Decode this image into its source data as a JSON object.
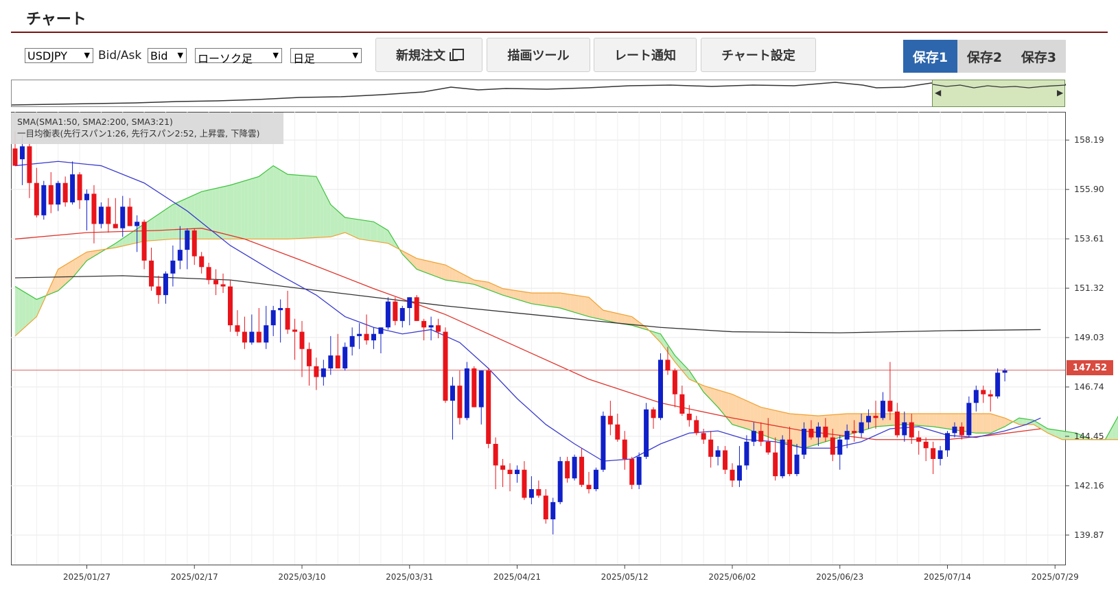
{
  "page": {
    "title": "チャート"
  },
  "toolbar": {
    "symbol": "USDJPY",
    "bidask_label": "Bid/Ask",
    "bidask_value": "Bid",
    "chart_type": "ローソク足",
    "period": "日足",
    "new_order_label": "新規注文",
    "draw_tool_label": "描画ツール",
    "rate_alert_label": "レート通知",
    "chart_settings_label": "チャート設定",
    "saves": [
      "保存1",
      "保存2",
      "保存3"
    ],
    "active_save": "保存1"
  },
  "legend": {
    "sma": "SMA(SMA1:50, SMA2:200, SMA3:21)",
    "ichimoku": "一目均衡表(先行スパン1:26, 先行スパン2:52, 上昇雲, 下降雲)"
  },
  "last_price_label": "147.52",
  "colors": {
    "up": "#e8141a",
    "down": "#1020c8",
    "sma1": "#e0332a",
    "sma2": "#333333",
    "sma3": "#3a3acf",
    "cloud_up": "#bfeebe",
    "cloud_down": "#fdd5a6",
    "span1": "#3cc23c",
    "span2": "#f0a030",
    "price_line": "#e08080",
    "accent": "#2d66ad"
  },
  "chart_data": {
    "type": "candlestick",
    "y_axis_ticks": [
      "158.19",
      "155.90",
      "153.61",
      "151.32",
      "149.03",
      "146.74",
      "144.45",
      "142.16",
      "139.87"
    ],
    "ylim": [
      138.5,
      159.5
    ],
    "x_axis_ticks": [
      "2025/01/27",
      "2025/02/17",
      "2025/03/10",
      "2025/03/31",
      "2025/04/21",
      "2025/05/12",
      "2025/06/02",
      "2025/06/23",
      "2025/07/14",
      "2025/07/29"
    ],
    "last_price": 147.52,
    "candles": [
      [
        157.8,
        158.6,
        157.0,
        157.0
      ],
      [
        157.3,
        158.4,
        156.1,
        157.9
      ],
      [
        157.9,
        158.1,
        155.5,
        156.2
      ],
      [
        156.2,
        156.9,
        154.6,
        154.7
      ],
      [
        154.7,
        156.3,
        154.5,
        156.1
      ],
      [
        156.1,
        156.7,
        154.8,
        155.2
      ],
      [
        155.2,
        156.3,
        154.9,
        156.2
      ],
      [
        156.2,
        156.5,
        155.1,
        155.3
      ],
      [
        155.3,
        157.2,
        155.2,
        156.6
      ],
      [
        156.6,
        156.7,
        155.0,
        155.4
      ],
      [
        155.4,
        155.9,
        154.0,
        155.7
      ],
      [
        155.7,
        156.1,
        153.4,
        154.3
      ],
      [
        154.3,
        155.3,
        154.1,
        155.1
      ],
      [
        155.1,
        155.5,
        153.9,
        154.3
      ],
      [
        154.3,
        155.5,
        154.1,
        154.1
      ],
      [
        154.1,
        155.6,
        153.7,
        155.1
      ],
      [
        155.1,
        155.5,
        154.2,
        154.2
      ],
      [
        154.2,
        154.7,
        153.0,
        154.4
      ],
      [
        154.4,
        154.5,
        152.2,
        152.6
      ],
      [
        152.6,
        153.2,
        151.2,
        151.4
      ],
      [
        151.4,
        151.9,
        150.6,
        151.0
      ],
      [
        151.0,
        152.1,
        150.6,
        152.0
      ],
      [
        152.0,
        153.3,
        151.4,
        152.6
      ],
      [
        152.6,
        154.2,
        152.2,
        153.1
      ],
      [
        153.1,
        154.1,
        152.2,
        154.0
      ],
      [
        154.0,
        154.1,
        152.4,
        152.8
      ],
      [
        152.8,
        153.0,
        152.0,
        152.3
      ],
      [
        152.3,
        152.5,
        151.5,
        151.7
      ],
      [
        151.7,
        152.2,
        151.0,
        151.5
      ],
      [
        151.5,
        152.0,
        151.1,
        151.4
      ],
      [
        151.4,
        151.7,
        149.3,
        149.6
      ],
      [
        149.6,
        150.3,
        149.1,
        149.3
      ],
      [
        149.3,
        150.0,
        148.5,
        148.8
      ],
      [
        148.8,
        150.1,
        148.7,
        149.3
      ],
      [
        149.3,
        150.4,
        148.8,
        148.8
      ],
      [
        148.8,
        150.5,
        148.5,
        149.6
      ],
      [
        149.6,
        150.5,
        149.1,
        150.3
      ],
      [
        150.3,
        150.8,
        148.8,
        150.4
      ],
      [
        150.4,
        151.2,
        149.2,
        149.4
      ],
      [
        149.4,
        149.9,
        148.0,
        149.3
      ],
      [
        149.3,
        149.8,
        147.2,
        148.5
      ],
      [
        148.5,
        148.8,
        146.8,
        147.7
      ],
      [
        147.7,
        148.1,
        146.6,
        147.2
      ],
      [
        147.2,
        148.0,
        146.8,
        147.6
      ],
      [
        147.6,
        149.1,
        147.3,
        148.2
      ],
      [
        148.2,
        149.2,
        147.8,
        147.6
      ],
      [
        147.6,
        148.8,
        147.5,
        148.6
      ],
      [
        148.6,
        149.5,
        148.2,
        149.1
      ],
      [
        149.1,
        149.7,
        148.5,
        149.2
      ],
      [
        149.2,
        150.1,
        148.7,
        148.9
      ],
      [
        148.9,
        149.5,
        148.5,
        149.2
      ],
      [
        149.2,
        149.5,
        148.3,
        149.5
      ],
      [
        149.5,
        150.9,
        149.4,
        150.7
      ],
      [
        150.7,
        150.9,
        149.6,
        149.8
      ],
      [
        149.8,
        150.5,
        149.5,
        150.4
      ],
      [
        150.4,
        150.9,
        149.6,
        150.9
      ],
      [
        150.9,
        151.0,
        149.8,
        149.8
      ],
      [
        149.8,
        149.9,
        148.9,
        149.5
      ],
      [
        149.5,
        150.0,
        148.9,
        149.6
      ],
      [
        149.6,
        149.9,
        149.0,
        149.3
      ],
      [
        149.3,
        149.5,
        146.0,
        146.1
      ],
      [
        146.1,
        147.2,
        144.3,
        146.8
      ],
      [
        146.8,
        147.5,
        145.0,
        145.3
      ],
      [
        145.3,
        147.9,
        145.2,
        147.6
      ],
      [
        147.6,
        147.7,
        145.8,
        145.8
      ],
      [
        145.8,
        147.5,
        145.0,
        147.5
      ],
      [
        147.5,
        147.6,
        143.9,
        144.1
      ],
      [
        144.1,
        144.4,
        142.0,
        143.1
      ],
      [
        143.1,
        143.4,
        142.1,
        142.9
      ],
      [
        142.9,
        143.2,
        141.9,
        142.7
      ],
      [
        142.7,
        143.1,
        142.3,
        142.9
      ],
      [
        142.9,
        143.3,
        141.5,
        141.6
      ],
      [
        141.6,
        142.6,
        141.3,
        142.0
      ],
      [
        142.0,
        142.4,
        141.6,
        141.7
      ],
      [
        141.7,
        142.0,
        140.4,
        140.6
      ],
      [
        140.6,
        141.6,
        139.9,
        141.4
      ],
      [
        141.4,
        143.5,
        141.3,
        143.3
      ],
      [
        143.3,
        143.5,
        142.3,
        142.5
      ],
      [
        142.5,
        143.6,
        142.4,
        143.5
      ],
      [
        143.5,
        143.9,
        142.1,
        142.2
      ],
      [
        142.2,
        142.8,
        141.8,
        142.0
      ],
      [
        142.0,
        143.0,
        141.9,
        142.9
      ],
      [
        142.9,
        145.6,
        142.8,
        145.4
      ],
      [
        145.4,
        146.1,
        144.5,
        145.0
      ],
      [
        145.0,
        145.5,
        144.2,
        144.3
      ],
      [
        144.3,
        144.7,
        142.9,
        143.4
      ],
      [
        143.4,
        143.5,
        142.0,
        142.2
      ],
      [
        142.2,
        143.7,
        142.0,
        143.5
      ],
      [
        143.5,
        146.0,
        143.4,
        145.7
      ],
      [
        145.7,
        145.8,
        144.8,
        145.3
      ],
      [
        145.3,
        148.3,
        145.2,
        148.0
      ],
      [
        148.0,
        148.6,
        147.3,
        147.5
      ],
      [
        147.5,
        147.6,
        145.8,
        146.4
      ],
      [
        146.4,
        146.8,
        145.4,
        145.5
      ],
      [
        145.5,
        145.9,
        144.9,
        145.2
      ],
      [
        145.2,
        145.4,
        144.5,
        144.6
      ],
      [
        144.6,
        144.8,
        144.1,
        144.3
      ],
      [
        144.3,
        144.7,
        143.0,
        143.5
      ],
      [
        143.5,
        144.0,
        143.1,
        143.8
      ],
      [
        143.8,
        144.0,
        142.7,
        142.9
      ],
      [
        142.9,
        143.2,
        142.1,
        142.4
      ],
      [
        142.4,
        144.0,
        142.1,
        143.1
      ],
      [
        143.1,
        144.5,
        142.9,
        144.2
      ],
      [
        144.2,
        145.1,
        144.0,
        144.7
      ],
      [
        144.7,
        145.1,
        144.0,
        144.2
      ],
      [
        144.2,
        145.3,
        143.6,
        143.7
      ],
      [
        143.7,
        144.4,
        142.4,
        142.6
      ],
      [
        142.6,
        144.5,
        142.5,
        144.3
      ],
      [
        144.3,
        144.9,
        142.6,
        142.7
      ],
      [
        142.7,
        144.1,
        142.6,
        143.6
      ],
      [
        143.6,
        145.1,
        143.4,
        144.8
      ],
      [
        144.8,
        145.2,
        144.3,
        144.4
      ],
      [
        144.4,
        145.1,
        144.0,
        144.9
      ],
      [
        144.9,
        145.3,
        144.2,
        144.4
      ],
      [
        144.4,
        144.8,
        143.3,
        143.6
      ],
      [
        143.6,
        144.5,
        142.9,
        144.3
      ],
      [
        144.3,
        145.0,
        143.9,
        144.7
      ],
      [
        144.7,
        145.2,
        144.2,
        144.6
      ],
      [
        144.6,
        145.5,
        144.4,
        145.1
      ],
      [
        145.1,
        145.7,
        144.8,
        145.4
      ],
      [
        145.4,
        146.1,
        144.8,
        145.3
      ],
      [
        145.3,
        146.5,
        145.2,
        146.1
      ],
      [
        146.1,
        147.9,
        145.2,
        145.6
      ],
      [
        145.6,
        146.0,
        144.4,
        144.5
      ],
      [
        144.5,
        145.6,
        144.2,
        145.1
      ],
      [
        145.1,
        145.5,
        144.1,
        144.4
      ],
      [
        144.4,
        144.7,
        143.6,
        144.2
      ],
      [
        144.2,
        144.4,
        143.3,
        143.9
      ],
      [
        143.9,
        144.2,
        142.7,
        143.4
      ],
      [
        143.4,
        144.0,
        143.1,
        143.8
      ],
      [
        143.8,
        144.7,
        143.5,
        144.6
      ],
      [
        144.6,
        145.1,
        144.4,
        144.9
      ],
      [
        144.9,
        145.1,
        144.3,
        144.5
      ],
      [
        144.5,
        146.3,
        144.4,
        146.0
      ],
      [
        146.0,
        146.8,
        145.6,
        146.6
      ],
      [
        146.6,
        146.8,
        146.0,
        146.4
      ],
      [
        146.4,
        146.6,
        145.6,
        146.3
      ],
      [
        146.3,
        147.6,
        146.2,
        147.4
      ],
      [
        147.4,
        147.6,
        147.0,
        147.5
      ]
    ],
    "sma1": [
      [
        0,
        153.6
      ],
      [
        10,
        153.9
      ],
      [
        20,
        154.0
      ],
      [
        26,
        154.1
      ],
      [
        32,
        153.6
      ],
      [
        40,
        152.6
      ],
      [
        50,
        151.3
      ],
      [
        60,
        150.1
      ],
      [
        70,
        148.6
      ],
      [
        80,
        147.1
      ],
      [
        90,
        146.0
      ],
      [
        100,
        145.3
      ],
      [
        110,
        144.7
      ],
      [
        120,
        144.3
      ],
      [
        130,
        144.3
      ],
      [
        136,
        144.5
      ],
      [
        143,
        144.8
      ]
    ],
    "sma2": [
      [
        0,
        151.8
      ],
      [
        15,
        151.9
      ],
      [
        30,
        151.7
      ],
      [
        45,
        151.1
      ],
      [
        60,
        150.5
      ],
      [
        75,
        150.0
      ],
      [
        90,
        149.5
      ],
      [
        100,
        149.3
      ],
      [
        115,
        149.25
      ],
      [
        130,
        149.35
      ],
      [
        143,
        149.4
      ]
    ],
    "sma3": [
      [
        0,
        157.0
      ],
      [
        6,
        157.2
      ],
      [
        12,
        157.0
      ],
      [
        18,
        156.2
      ],
      [
        24,
        154.9
      ],
      [
        30,
        153.3
      ],
      [
        36,
        152.1
      ],
      [
        42,
        151.0
      ],
      [
        46,
        150.0
      ],
      [
        50,
        149.5
      ],
      [
        54,
        149.2
      ],
      [
        58,
        149.4
      ],
      [
        62,
        148.8
      ],
      [
        66,
        147.6
      ],
      [
        70,
        146.2
      ],
      [
        74,
        145.0
      ],
      [
        78,
        144.1
      ],
      [
        82,
        143.3
      ],
      [
        86,
        143.4
      ],
      [
        90,
        144.1
      ],
      [
        94,
        144.6
      ],
      [
        98,
        144.7
      ],
      [
        102,
        144.3
      ],
      [
        106,
        144.2
      ],
      [
        110,
        143.9
      ],
      [
        114,
        143.9
      ],
      [
        118,
        144.2
      ],
      [
        122,
        144.8
      ],
      [
        126,
        144.9
      ],
      [
        130,
        144.5
      ],
      [
        134,
        144.4
      ],
      [
        138,
        144.7
      ],
      [
        141,
        145.0
      ],
      [
        143,
        145.3
      ]
    ],
    "span1": [
      [
        0,
        151.4
      ],
      [
        3,
        150.8
      ],
      [
        6,
        151.2
      ],
      [
        8,
        151.8
      ],
      [
        10,
        152.6
      ],
      [
        14,
        153.4
      ],
      [
        18,
        154.3
      ],
      [
        22,
        155.2
      ],
      [
        26,
        155.8
      ],
      [
        30,
        156.1
      ],
      [
        34,
        156.5
      ],
      [
        36,
        157.0
      ],
      [
        38,
        156.6
      ],
      [
        42,
        156.5
      ],
      [
        44,
        155.2
      ],
      [
        46,
        154.6
      ],
      [
        50,
        154.4
      ],
      [
        52,
        154.0
      ],
      [
        54,
        152.9
      ],
      [
        56,
        152.2
      ],
      [
        60,
        151.7
      ],
      [
        64,
        151.5
      ],
      [
        68,
        151.0
      ],
      [
        72,
        150.6
      ],
      [
        76,
        150.4
      ],
      [
        80,
        150.0
      ],
      [
        84,
        149.7
      ],
      [
        86,
        149.6
      ],
      [
        88,
        149.4
      ],
      [
        90,
        149.2
      ],
      [
        92,
        148.2
      ],
      [
        94,
        147.5
      ],
      [
        96,
        146.5
      ],
      [
        98,
        145.8
      ],
      [
        100,
        145.0
      ],
      [
        102,
        144.8
      ],
      [
        106,
        144.3
      ],
      [
        110,
        143.9
      ],
      [
        112,
        144.1
      ],
      [
        116,
        144.5
      ],
      [
        120,
        144.9
      ],
      [
        124,
        145.0
      ],
      [
        128,
        144.9
      ],
      [
        132,
        144.7
      ],
      [
        134,
        144.6
      ],
      [
        136,
        144.6
      ],
      [
        138,
        144.9
      ],
      [
        140,
        145.3
      ],
      [
        142,
        145.2
      ],
      [
        144,
        144.8
      ],
      [
        146,
        144.7
      ],
      [
        148,
        144.6
      ],
      [
        150,
        144.3
      ],
      [
        152,
        144.3
      ],
      [
        154,
        145.5
      ],
      [
        158,
        145.5
      ]
    ],
    "span2": [
      [
        0,
        149.1
      ],
      [
        3,
        150.0
      ],
      [
        6,
        152.2
      ],
      [
        10,
        153.0
      ],
      [
        14,
        153.2
      ],
      [
        18,
        153.5
      ],
      [
        22,
        153.6
      ],
      [
        30,
        153.6
      ],
      [
        38,
        153.6
      ],
      [
        44,
        153.7
      ],
      [
        46,
        153.9
      ],
      [
        48,
        153.6
      ],
      [
        52,
        153.4
      ],
      [
        56,
        152.7
      ],
      [
        60,
        152.4
      ],
      [
        64,
        151.7
      ],
      [
        66,
        151.6
      ],
      [
        68,
        151.3
      ],
      [
        72,
        151.1
      ],
      [
        76,
        151.1
      ],
      [
        80,
        150.9
      ],
      [
        82,
        150.3
      ],
      [
        86,
        150.0
      ],
      [
        88,
        149.5
      ],
      [
        90,
        148.8
      ],
      [
        92,
        147.9
      ],
      [
        94,
        147.1
      ],
      [
        96,
        146.8
      ],
      [
        100,
        146.4
      ],
      [
        104,
        145.8
      ],
      [
        108,
        145.5
      ],
      [
        112,
        145.4
      ],
      [
        116,
        145.5
      ],
      [
        120,
        145.5
      ],
      [
        124,
        145.5
      ],
      [
        128,
        145.5
      ],
      [
        132,
        145.5
      ],
      [
        136,
        145.5
      ],
      [
        138,
        145.3
      ],
      [
        140,
        145.0
      ],
      [
        142,
        145.0
      ],
      [
        144,
        144.6
      ],
      [
        146,
        144.3
      ],
      [
        150,
        144.3
      ],
      [
        158,
        144.3
      ]
    ],
    "x_tick_positions": [
      10,
      25,
      40,
      55,
      70,
      85,
      100,
      115,
      130,
      145
    ]
  }
}
